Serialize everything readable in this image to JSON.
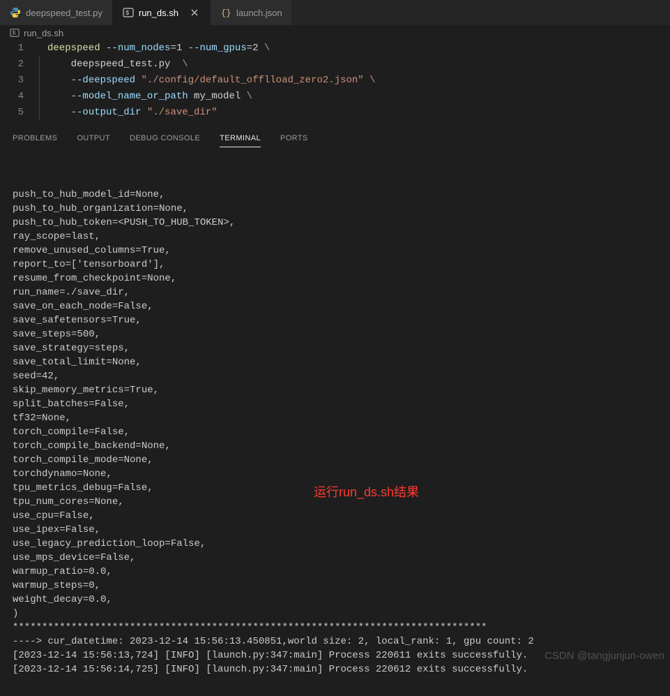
{
  "tabs": [
    {
      "label": "deepspeed_test.py",
      "type": "python",
      "active": false
    },
    {
      "label": "run_ds.sh",
      "type": "shell",
      "active": true
    },
    {
      "label": "launch.json",
      "type": "json",
      "active": false
    }
  ],
  "breadcrumb": {
    "icon": "shell",
    "label": "run_ds.sh"
  },
  "editor": {
    "lines": [
      "deepspeed --num_nodes=1 --num_gpus=2 \\",
      "    deepspeed_test.py  \\",
      "    --deepspeed \"./config/default_offlload_zero2.json\" \\",
      "    --model_name_or_path my_model \\",
      "    --output_dir \"./save_dir\""
    ]
  },
  "panel": {
    "tabs": [
      "PROBLEMS",
      "OUTPUT",
      "DEBUG CONSOLE",
      "TERMINAL",
      "PORTS"
    ],
    "active": "TERMINAL"
  },
  "terminal_output": [
    "push_to_hub_model_id=None,",
    "push_to_hub_organization=None,",
    "push_to_hub_token=<PUSH_TO_HUB_TOKEN>,",
    "ray_scope=last,",
    "remove_unused_columns=True,",
    "report_to=['tensorboard'],",
    "resume_from_checkpoint=None,",
    "run_name=./save_dir,",
    "save_on_each_node=False,",
    "save_safetensors=True,",
    "save_steps=500,",
    "save_strategy=steps,",
    "save_total_limit=None,",
    "seed=42,",
    "skip_memory_metrics=True,",
    "split_batches=False,",
    "tf32=None,",
    "torch_compile=False,",
    "torch_compile_backend=None,",
    "torch_compile_mode=None,",
    "torchdynamo=None,",
    "tpu_metrics_debug=False,",
    "tpu_num_cores=None,",
    "use_cpu=False,",
    "use_ipex=False,",
    "use_legacy_prediction_loop=False,",
    "use_mps_device=False,",
    "warmup_ratio=0.0,",
    "warmup_steps=0,",
    "weight_decay=0.0,",
    ")",
    "*********************************************************************************",
    "----> cur_datetime: 2023-12-14 15:56:13.450851,world size: 2, local_rank: 1, gpu count: 2",
    "[2023-12-14 15:56:13,724] [INFO] [launch.py:347:main] Process 220611 exits successfully.",
    "[2023-12-14 15:56:14,725] [INFO] [launch.py:347:main] Process 220612 exits successfully."
  ],
  "annotation": "运行run_ds.sh结果",
  "watermark": "CSDN @tangjunjun-owen"
}
